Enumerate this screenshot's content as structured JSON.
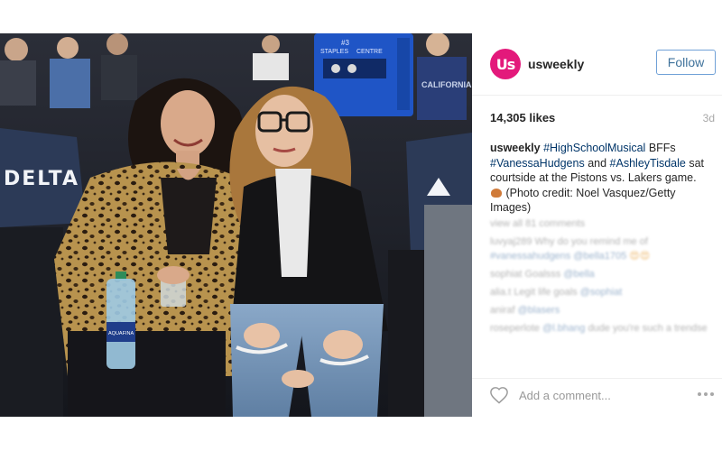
{
  "post": {
    "username": "usweekly",
    "avatar_text": "Us",
    "follow_label": "Follow",
    "likes": "14,305 likes",
    "time": "3d",
    "caption": {
      "author": "usweekly",
      "tag_hsm": "#HighSchoolMusical",
      "bffs": "BFFs",
      "tag_vanessa": "#VanessaHudgens",
      "and": "and",
      "tag_ashley": "#AshleyTisdale",
      "text1": "sat courtside at the Pistons vs. Lakers game.",
      "text2": "(Photo credit: Noel Vasquez/Getty Images)"
    },
    "comments": {
      "view_all": "view all 81 comments",
      "c1_user": "luvyaj289",
      "c1_text": "Why do you remind me of",
      "c1_tags": "#vanessahudgens @bella1705",
      "c1_emoji": "😍😍",
      "c2_user": "sophiat",
      "c2_text": "Goalsss",
      "c2_tag": "@bella",
      "c3_user": "alia.t",
      "c3_text": "Legit life goals",
      "c3_tag": "@sophiat",
      "c4_user": "aniraf",
      "c4_tag": "@blasers",
      "c5_user": "roseperlote",
      "c5_tag": "@l.bhang",
      "c5_text": "dude you're such a trendsetter"
    },
    "comment_placeholder": "Add a comment..."
  },
  "photo": {
    "sign_delta": "DELTA",
    "sign_staples": "STAPLES",
    "sign_centre": "CENTRE",
    "sign_number": "#3",
    "bottle_label": "AQUAFINA",
    "shirt_text": "CALIFORNIA"
  },
  "colors": {
    "brand_pink": "#e3197b",
    "link_blue": "#003569",
    "follow_border": "#70a1d7"
  }
}
